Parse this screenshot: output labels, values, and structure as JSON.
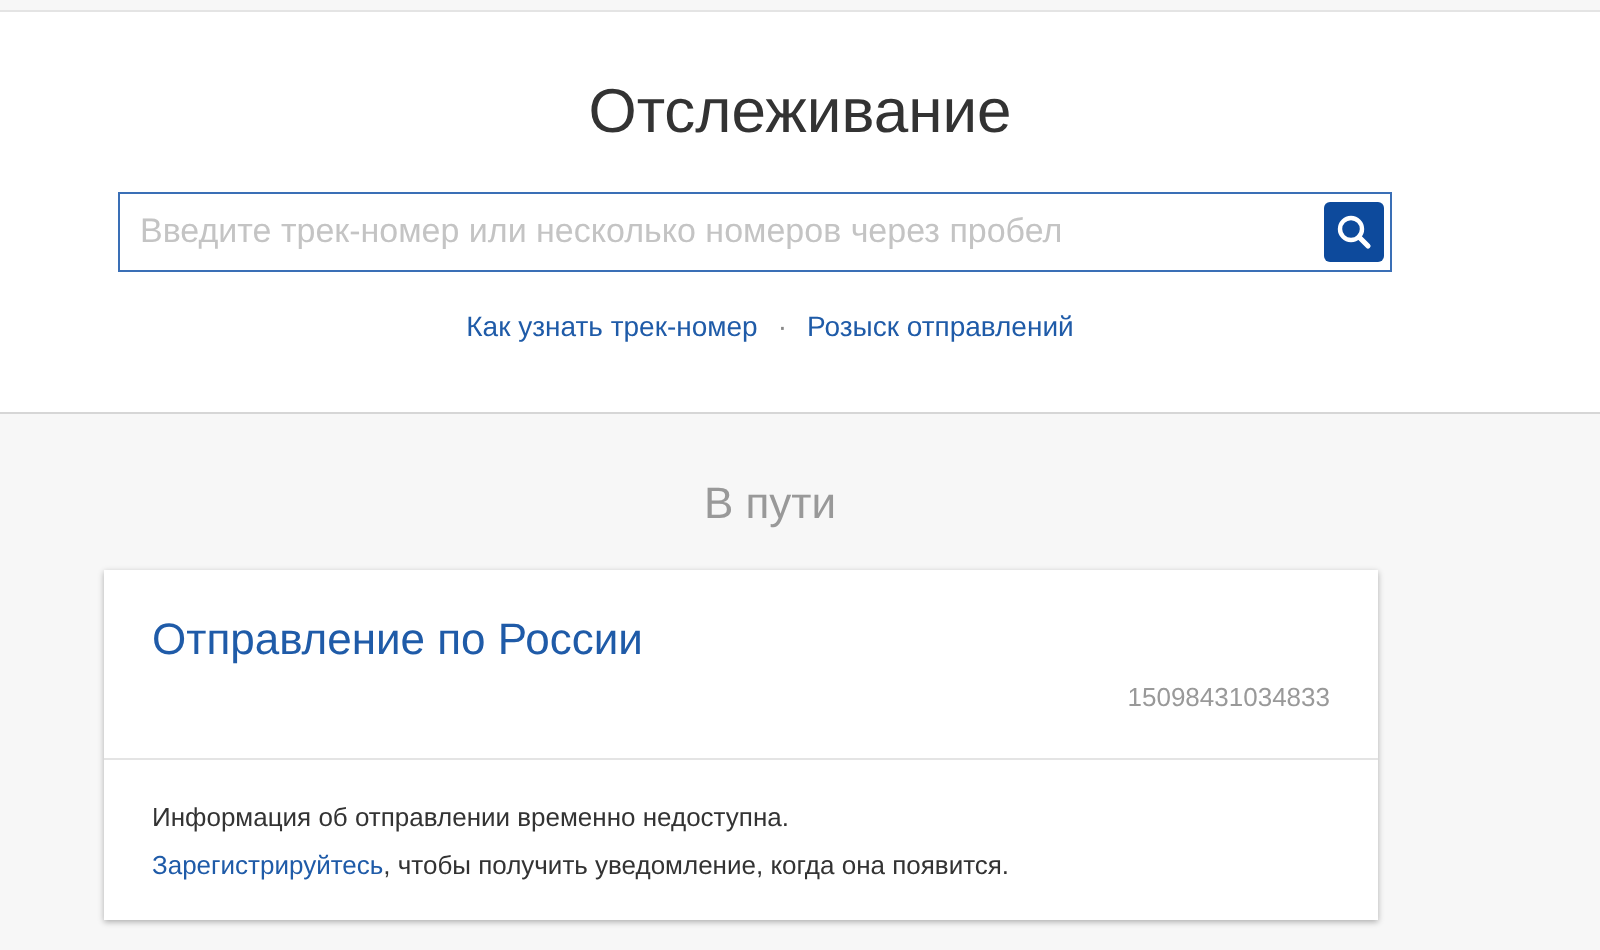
{
  "header": {
    "title": "Отслеживание",
    "search": {
      "placeholder": "Введите трек-номер или несколько номеров через пробел"
    },
    "links": [
      {
        "label": "Как узнать трек-номер"
      },
      {
        "label": "Розыск отправлений"
      }
    ],
    "separator": "·"
  },
  "section": {
    "title": "В пути",
    "card": {
      "title": "Отправление по России",
      "track_number": "15098431034833",
      "message": "Информация об отправлении временно недоступна.",
      "register_link": "Зарегистрируйтесь",
      "register_text": ", чтобы получить уведомление, когда она появится."
    }
  }
}
